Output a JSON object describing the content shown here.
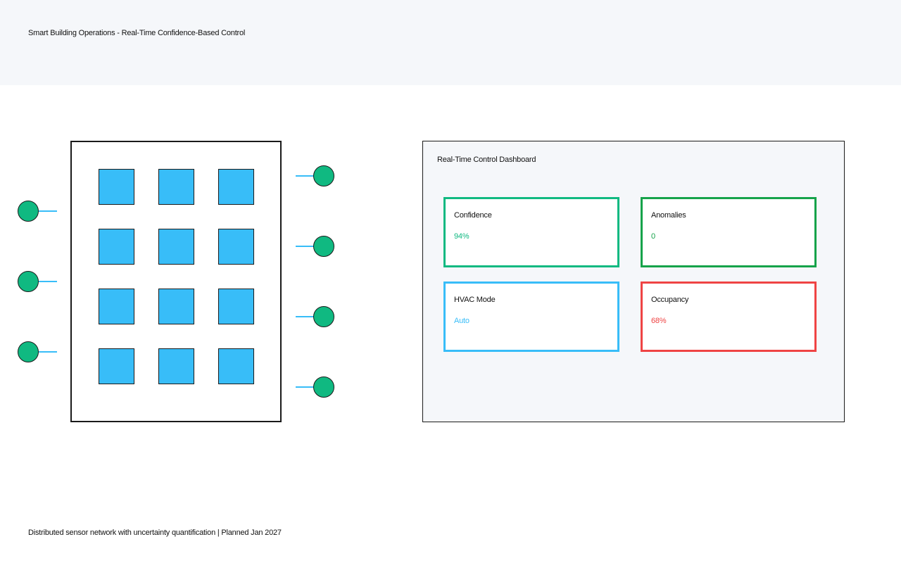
{
  "header": {
    "title": "Smart Building Operations - Real-Time Confidence-Based Control"
  },
  "building": {
    "room_color": "#38bdf8",
    "rooms": 12
  },
  "sensors": {
    "color": "#10b981",
    "link_color": "#38bdf8"
  },
  "dashboard": {
    "title": "Real-Time Control Dashboard",
    "cards": [
      {
        "label": "Confidence",
        "value": "94%",
        "color": "#10b981"
      },
      {
        "label": "Anomalies",
        "value": "0",
        "color": "#16a34a"
      },
      {
        "label": "HVAC Mode",
        "value": "Auto",
        "color": "#38bdf8"
      },
      {
        "label": "Occupancy",
        "value": "68%",
        "color": "#ef4444"
      }
    ]
  },
  "footer": {
    "text": "Distributed sensor network with uncertainty quantification | Planned Jan 2027"
  }
}
